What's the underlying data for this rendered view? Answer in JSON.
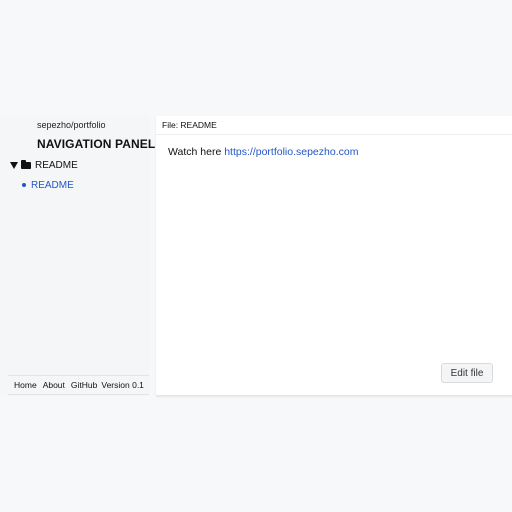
{
  "sidebar": {
    "repo": "sepezho/portfolio",
    "title": "NAVIGATION PANEL",
    "tree": {
      "folder_label": "README",
      "file_label": "README"
    },
    "footer": {
      "home": "Home",
      "about": "About",
      "github": "GitHub",
      "version": "Version 0.1"
    }
  },
  "main": {
    "header": "File: README",
    "content_prefix": "Watch here ",
    "content_link": "https://portfolio.sepezho.com",
    "edit_button": "Edit file"
  },
  "colors": {
    "link": "#2456c8",
    "background": "#f7f8fa",
    "panel": "#ffffff"
  },
  "icons": [
    "caret-down-icon",
    "folder-icon",
    "dot-icon"
  ]
}
